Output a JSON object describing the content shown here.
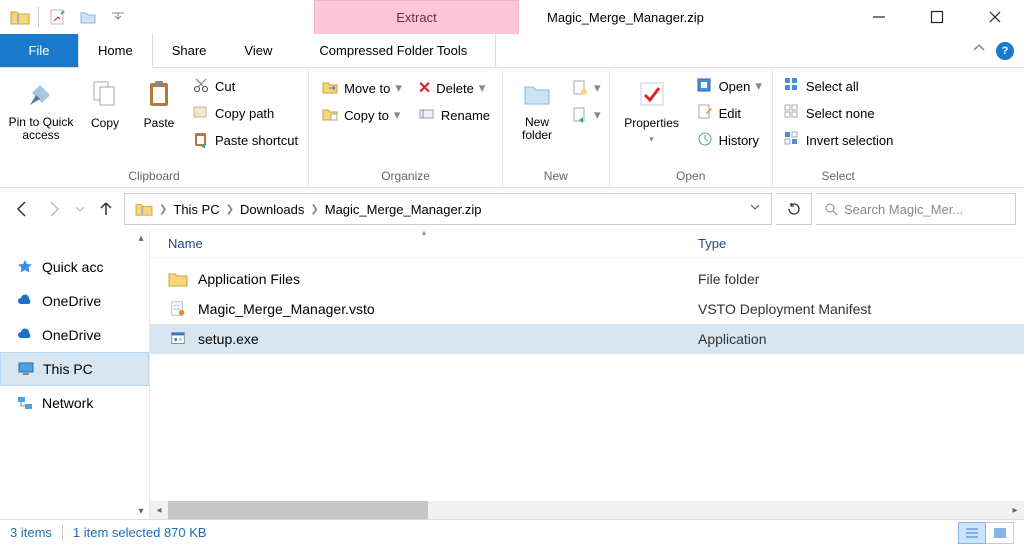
{
  "titlebar": {
    "context_tab": "Extract",
    "window_title": "Magic_Merge_Manager.zip"
  },
  "tabs": {
    "file": "File",
    "home": "Home",
    "share": "Share",
    "view": "View",
    "compressed": "Compressed Folder Tools"
  },
  "ribbon": {
    "clipboard": {
      "pin": "Pin to Quick access",
      "copy": "Copy",
      "paste": "Paste",
      "cut": "Cut",
      "copy_path": "Copy path",
      "paste_shortcut": "Paste shortcut",
      "label": "Clipboard"
    },
    "organize": {
      "move_to": "Move to",
      "copy_to": "Copy to",
      "delete": "Delete",
      "rename": "Rename",
      "label": "Organize"
    },
    "new": {
      "new_folder": "New folder",
      "label": "New"
    },
    "open": {
      "properties": "Properties",
      "open": "Open",
      "edit": "Edit",
      "history": "History",
      "label": "Open"
    },
    "select": {
      "select_all": "Select all",
      "select_none": "Select none",
      "invert": "Invert selection",
      "label": "Select"
    }
  },
  "breadcrumb": {
    "seg1": "This PC",
    "seg2": "Downloads",
    "seg3": "Magic_Merge_Manager.zip"
  },
  "search": {
    "placeholder": "Search Magic_Mer..."
  },
  "nav": {
    "quick_access": "Quick acc",
    "onedrive1": "OneDrive",
    "onedrive2": "OneDrive",
    "this_pc": "This PC",
    "network": "Network"
  },
  "columns": {
    "name": "Name",
    "type": "Type"
  },
  "files": [
    {
      "name": "Application Files",
      "type": "File folder",
      "icon": "folder"
    },
    {
      "name": "Magic_Merge_Manager.vsto",
      "type": "VSTO Deployment Manifest",
      "icon": "vsto"
    },
    {
      "name": "setup.exe",
      "type": "Application",
      "icon": "exe",
      "selected": true
    }
  ],
  "status": {
    "items": "3 items",
    "selection": "1 item selected  870 KB"
  }
}
